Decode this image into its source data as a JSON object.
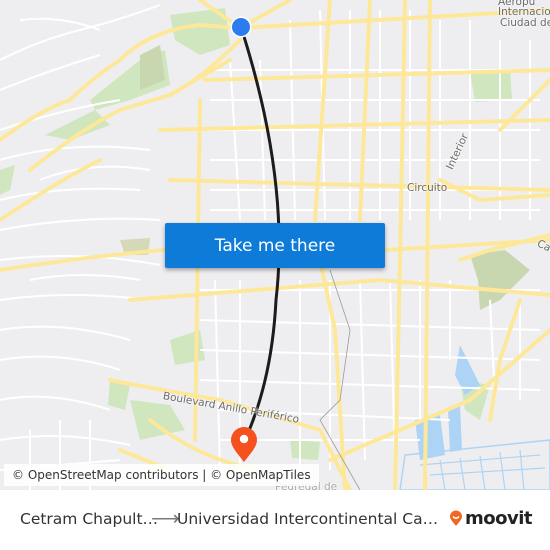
{
  "map": {
    "labels": {
      "airport_line1": "Aeropu",
      "airport_line2": "Internacior",
      "airport_line3": "Ciudad de",
      "circuito_interior": "Circuito Interior",
      "boulevard": "Boulevard Anillo Periférico",
      "calzada": "Ca",
      "pedregal": "Pedregal de"
    },
    "colors": {
      "background": "#eeeef0",
      "road_major": "#fde89a",
      "road_minor": "#ffffff",
      "park": "#cfe6bf",
      "water": "#aed4f5",
      "route_line": "#222222",
      "origin_marker": "#2d7bf0",
      "destination_marker": "#f4511e"
    },
    "origin_marker": "origin-pin-icon",
    "destination_marker": "destination-pin-icon"
  },
  "cta": {
    "label": "Take me there",
    "color": "#0f7bd9"
  },
  "attribution": "© OpenStreetMap contributors | © OpenMapTiles",
  "footer": {
    "origin": "Cetram Chapult…",
    "arrow": "⟶",
    "destination": "Universidad Intercontinental Ca…",
    "brand": "moovit",
    "brand_color": "#f26722"
  }
}
